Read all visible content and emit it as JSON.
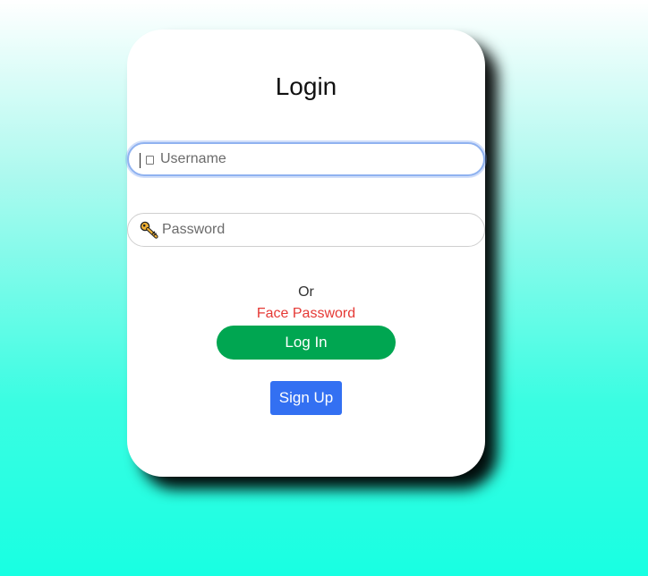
{
  "login": {
    "title": "Login",
    "username": {
      "placeholder": "Username",
      "value": "",
      "icon": "box-icon"
    },
    "password": {
      "placeholder": "Password",
      "value": "",
      "icon": "key-icon"
    },
    "or_text": "Or",
    "face_password_link": "Face Password",
    "login_button": "Log In",
    "signup_button": "Sign Up"
  },
  "colors": {
    "login_button": "#00a651",
    "signup_button": "#3370f2",
    "face_password_link": "#e53935",
    "focus_outline": "#8fb2f0",
    "background_bottom": "#18ffe2"
  }
}
